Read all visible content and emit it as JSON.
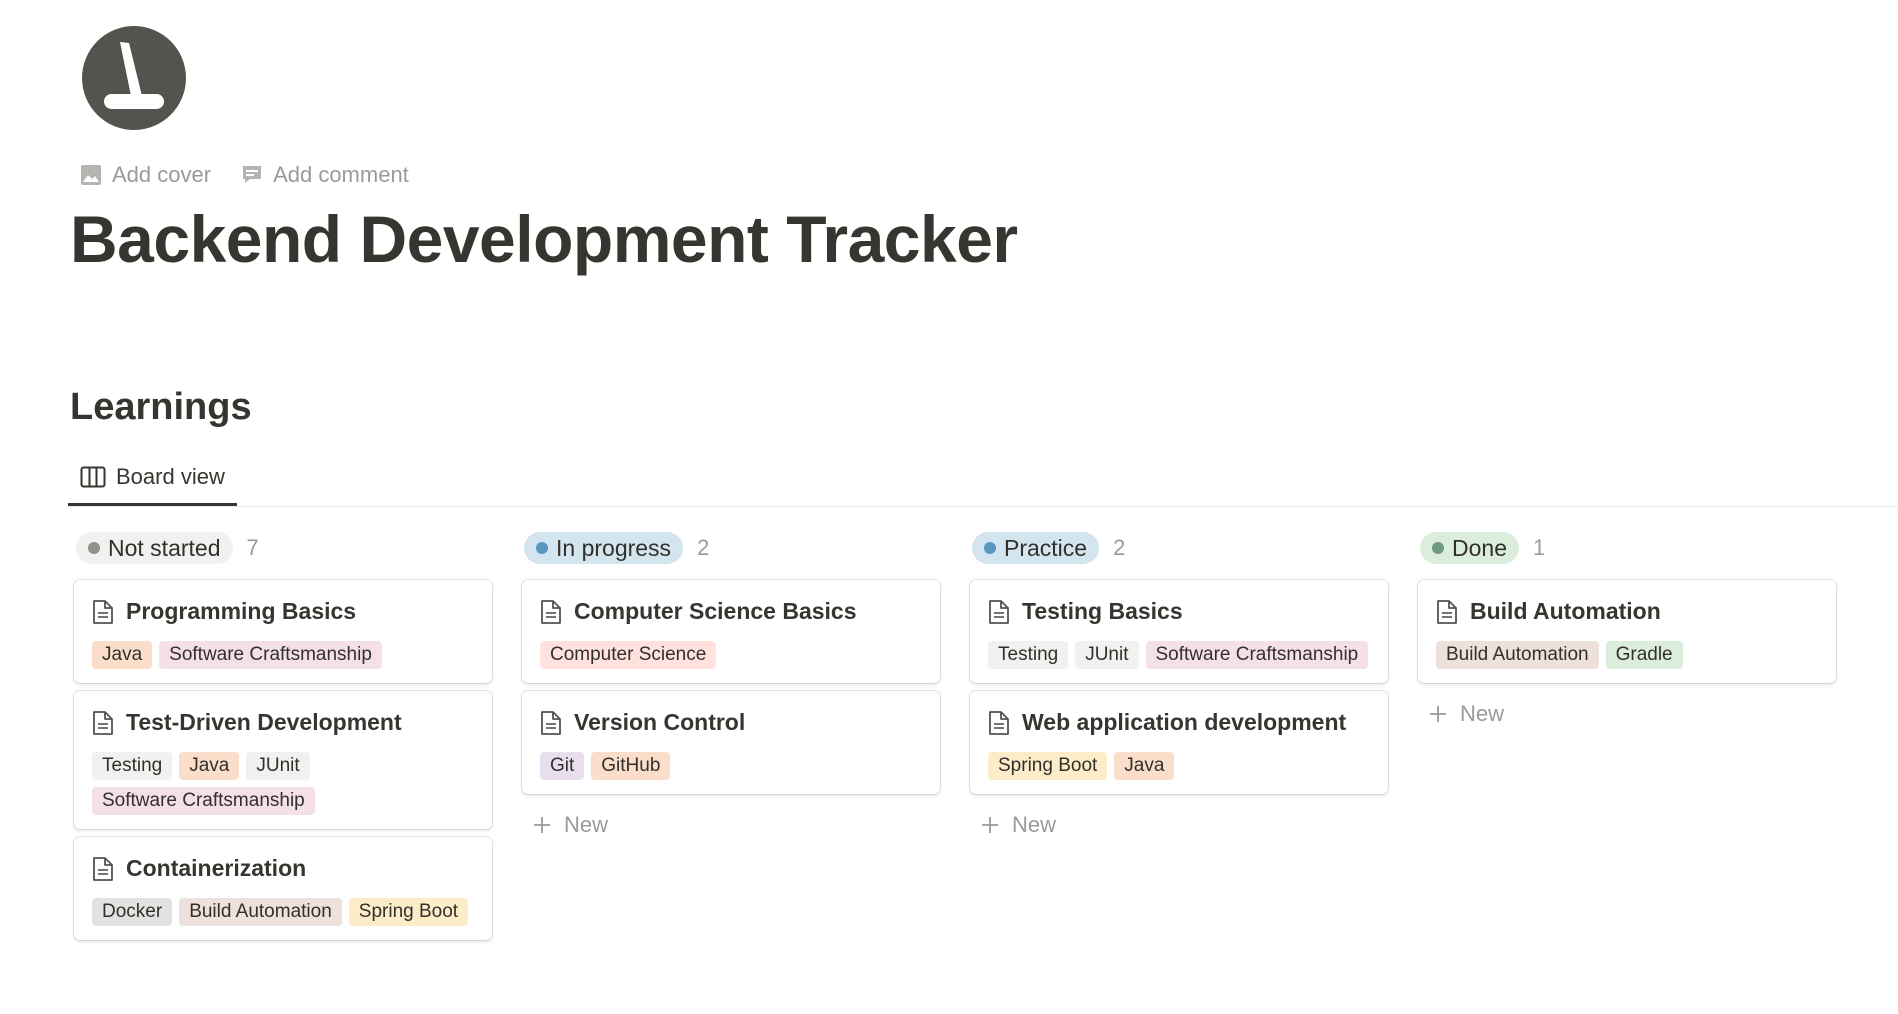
{
  "header": {
    "add_cover_label": "Add cover",
    "add_comment_label": "Add comment",
    "title": "Backend Development Tracker"
  },
  "section": {
    "title": "Learnings"
  },
  "view_tab": {
    "label": "Board view"
  },
  "board": {
    "new_label": "New",
    "columns": [
      {
        "status": "Not started",
        "count": "7",
        "dot_color": "#91918e",
        "pill_bg": "#f1f1ef",
        "show_new": false,
        "cards": [
          {
            "title": "Programming Basics",
            "tags": [
              "Java",
              "Software Craftsmanship"
            ]
          },
          {
            "title": "Test-Driven Development",
            "tags": [
              "Testing",
              "Java",
              "JUnit",
              "Software Craftsmanship"
            ]
          },
          {
            "title": "Containerization",
            "tags": [
              "Docker",
              "Build Automation",
              "Spring Boot"
            ]
          }
        ]
      },
      {
        "status": "In progress",
        "count": "2",
        "dot_color": "#5b97bd",
        "pill_bg": "#d3e5ef",
        "show_new": true,
        "cards": [
          {
            "title": "Computer Science Basics",
            "tags": [
              "Computer Science"
            ]
          },
          {
            "title": "Version Control",
            "tags": [
              "Git",
              "GitHub"
            ]
          }
        ]
      },
      {
        "status": "Practice",
        "count": "2",
        "dot_color": "#5b97bd",
        "pill_bg": "#d3e5ef",
        "show_new": true,
        "cards": [
          {
            "title": "Testing Basics",
            "tags": [
              "Testing",
              "JUnit",
              "Software Craftsmanship"
            ]
          },
          {
            "title": "Web application development",
            "tags": [
              "Spring Boot",
              "Java"
            ]
          }
        ]
      },
      {
        "status": "Done",
        "count": "1",
        "dot_color": "#6c9b7d",
        "pill_bg": "#dbeddb",
        "show_new": true,
        "cards": [
          {
            "title": "Build Automation",
            "tags": [
              "Build Automation",
              "Gradle"
            ]
          }
        ]
      }
    ]
  },
  "tag_colors": {
    "Java": "#fadec9",
    "Software Craftsmanship": "#f5e0e9",
    "Testing": "#f1f1ef",
    "JUnit": "#f1f1ef",
    "Docker": "#e3e2e0",
    "Build Automation": "#eee0da",
    "Spring Boot": "#fdecc8",
    "Computer Science": "#ffe2dd",
    "Git": "#e8deee",
    "GitHub": "#fadec9",
    "Gradle": "#dbeddb"
  },
  "icon_colors": {
    "page_icon": "#55534e",
    "muted": "#9b9a97"
  }
}
